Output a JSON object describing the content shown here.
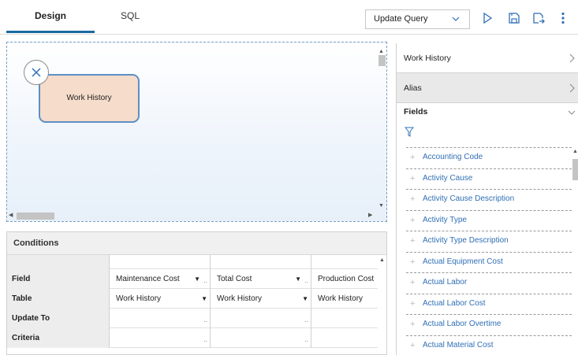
{
  "tabs": {
    "design": "Design",
    "sql": "SQL"
  },
  "toolbar": {
    "query_type": "Update Query",
    "icons": [
      "run-icon",
      "save-icon",
      "save-as-icon",
      "more-options-icon"
    ],
    "accent_color": "#1a6aa0"
  },
  "canvas": {
    "node_label": "Work History"
  },
  "conditions": {
    "header": "Conditions",
    "rows": [
      {
        "label": "Field",
        "c1": "Maintenance Cost",
        "c2": "Total Cost",
        "c3": "Production Cost"
      },
      {
        "label": "Table",
        "c1": "Work History",
        "c2": "Work History",
        "c3": "Work History"
      },
      {
        "label": "Update To",
        "c1": "",
        "c2": "",
        "c3": ""
      },
      {
        "label": "Criteria",
        "c1": "",
        "c2": "",
        "c3": ""
      }
    ]
  },
  "panel": {
    "source": "Work History",
    "alias": "Alias",
    "fields_title": "Fields",
    "fields": [
      "Accounting Code",
      "Activity Cause",
      "Activity Cause Description",
      "Activity Type",
      "Activity Type Description",
      "Actual Equipment Cost",
      "Actual Labor",
      "Actual Labor Cost",
      "Actual Labor Overtime",
      "Actual Material Cost"
    ],
    "link_color": "#2f6fb5"
  }
}
